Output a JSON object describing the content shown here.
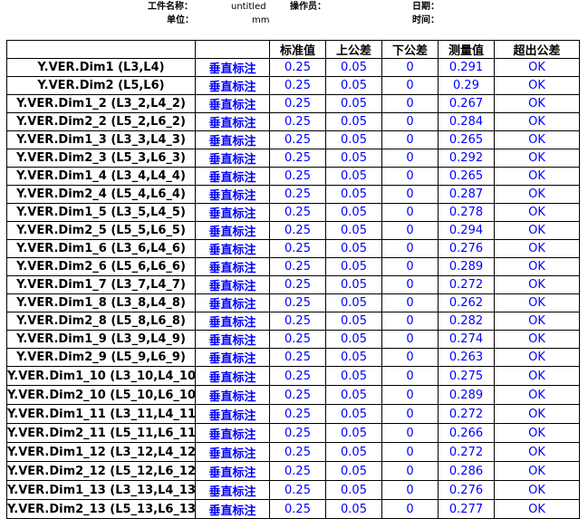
{
  "meta": {
    "file_label": "工件名称：",
    "file_value": "untitled",
    "unit_label": "单位：",
    "unit_value": "mm",
    "operator_label": "操作员：",
    "date_label": "日期：",
    "time_label": "时间："
  },
  "table": {
    "headers": [
      "",
      "",
      "标准值",
      "上公差",
      "下公差",
      "测量值",
      "超出公差"
    ],
    "rows": [
      [
        "Y.VER.Dim1  (L3,L4)",
        "垂直标注",
        "0.25",
        "0.05",
        "0",
        "0.291",
        "OK"
      ],
      [
        "Y.VER.Dim2  (L5,L6)",
        "垂直标注",
        "0.25",
        "0.05",
        "0",
        "0.29",
        "OK"
      ],
      [
        "Y.VER.Dim1_2  (L3_2,L4_2)",
        "垂直标注",
        "0.25",
        "0.05",
        "0",
        "0.267",
        "OK"
      ],
      [
        "Y.VER.Dim2_2  (L5_2,L6_2)",
        "垂直标注",
        "0.25",
        "0.05",
        "0",
        "0.284",
        "OK"
      ],
      [
        "Y.VER.Dim1_3  (L3_3,L4_3)",
        "垂直标注",
        "0.25",
        "0.05",
        "0",
        "0.265",
        "OK"
      ],
      [
        "Y.VER.Dim2_3  (L5_3,L6_3)",
        "垂直标注",
        "0.25",
        "0.05",
        "0",
        "0.292",
        "OK"
      ],
      [
        "Y.VER.Dim1_4  (L3_4,L4_4)",
        "垂直标注",
        "0.25",
        "0.05",
        "0",
        "0.265",
        "OK"
      ],
      [
        "Y.VER.Dim2_4  (L5_4,L6_4)",
        "垂直标注",
        "0.25",
        "0.05",
        "0",
        "0.287",
        "OK"
      ],
      [
        "Y.VER.Dim1_5  (L3_5,L4_5)",
        "垂直标注",
        "0.25",
        "0.05",
        "0",
        "0.278",
        "OK"
      ],
      [
        "Y.VER.Dim2_5  (L5_5,L6_5)",
        "垂直标注",
        "0.25",
        "0.05",
        "0",
        "0.294",
        "OK"
      ],
      [
        "Y.VER.Dim1_6  (L3_6,L4_6)",
        "垂直标注",
        "0.25",
        "0.05",
        "0",
        "0.276",
        "OK"
      ],
      [
        "Y.VER.Dim2_6  (L5_6,L6_6)",
        "垂直标注",
        "0.25",
        "0.05",
        "0",
        "0.289",
        "OK"
      ],
      [
        "Y.VER.Dim1_7  (L3_7,L4_7)",
        "垂直标注",
        "0.25",
        "0.05",
        "0",
        "0.272",
        "OK"
      ],
      [
        "Y.VER.Dim1_8  (L3_8,L4_8)",
        "垂直标注",
        "0.25",
        "0.05",
        "0",
        "0.262",
        "OK"
      ],
      [
        "Y.VER.Dim2_8  (L5_8,L6_8)",
        "垂直标注",
        "0.25",
        "0.05",
        "0",
        "0.282",
        "OK"
      ],
      [
        "Y.VER.Dim1_9  (L3_9,L4_9)",
        "垂直标注",
        "0.25",
        "0.05",
        "0",
        "0.274",
        "OK"
      ],
      [
        "Y.VER.Dim2_9  (L5_9,L6_9)",
        "垂直标注",
        "0.25",
        "0.05",
        "0",
        "0.263",
        "OK"
      ],
      [
        "Y.VER.Dim1_10  (L3_10,L4_10)",
        "垂直标注",
        "0.25",
        "0.05",
        "0",
        "0.275",
        "OK"
      ],
      [
        "Y.VER.Dim2_10  (L5_10,L6_10)",
        "垂直标注",
        "0.25",
        "0.05",
        "0",
        "0.289",
        "OK"
      ],
      [
        "Y.VER.Dim1_11  (L3_11,L4_11)",
        "垂直标注",
        "0.25",
        "0.05",
        "0",
        "0.272",
        "OK"
      ],
      [
        "Y.VER.Dim2_11  (L5_11,L6_11)",
        "垂直标注",
        "0.25",
        "0.05",
        "0",
        "0.266",
        "OK"
      ],
      [
        "Y.VER.Dim1_12  (L3_12,L4_12)",
        "垂直标注",
        "0.25",
        "0.05",
        "0",
        "0.272",
        "OK"
      ],
      [
        "Y.VER.Dim2_12  (L5_12,L6_12)",
        "垂直标注",
        "0.25",
        "0.05",
        "0",
        "0.286",
        "OK"
      ],
      [
        "Y.VER.Dim1_13  (L3_13,L4_13)",
        "垂直标注",
        "0.25",
        "0.05",
        "0",
        "0.276",
        "OK"
      ],
      [
        "Y.VER.Dim2_13  (L5_13,L6_13)",
        "垂直标注",
        "0.25",
        "0.05",
        "0",
        "0.277",
        "OK"
      ]
    ]
  },
  "colors": {
    "value_text": "#0000ff",
    "label_text": "#000000",
    "grid_line": "#000000"
  }
}
